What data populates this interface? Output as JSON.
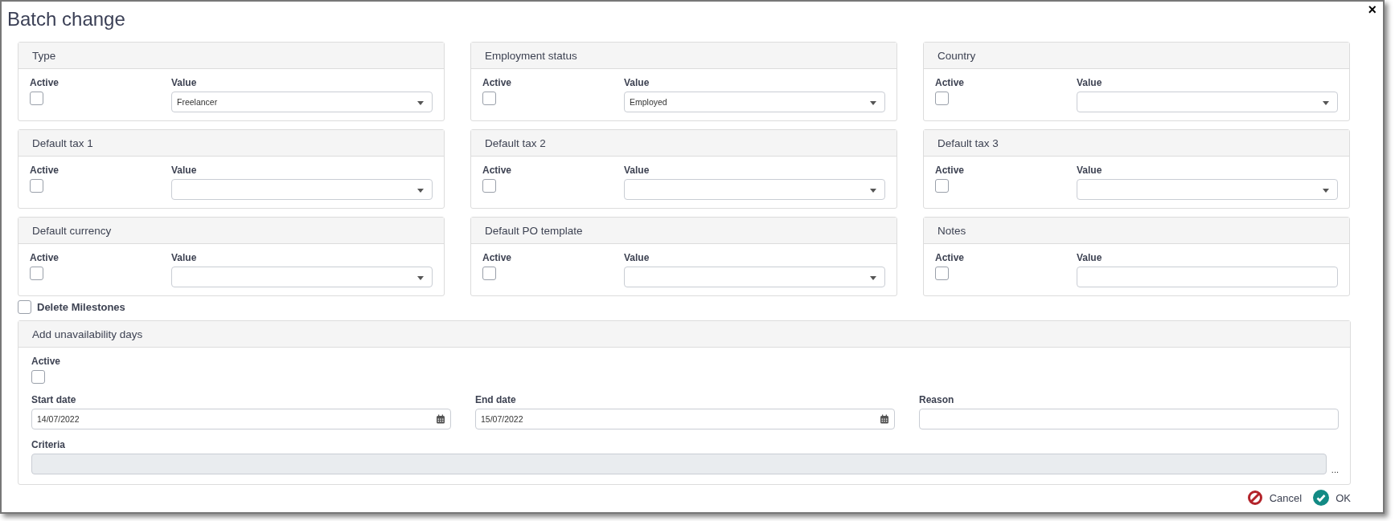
{
  "window": {
    "title": "Batch change",
    "close": "×"
  },
  "panels": [
    {
      "title": "Type",
      "active_label": "Active",
      "active_checked": false,
      "value_label": "Value",
      "kind": "select",
      "value": "Freelancer"
    },
    {
      "title": "Employment status",
      "active_label": "Active",
      "active_checked": false,
      "value_label": "Value",
      "kind": "select",
      "value": "Employed"
    },
    {
      "title": "Country",
      "active_label": "Active",
      "active_checked": false,
      "value_label": "Value",
      "kind": "select"
    },
    {
      "title": "Default tax 1",
      "active_label": "Active",
      "active_checked": false,
      "value_label": "Value",
      "kind": "select"
    },
    {
      "title": "Default tax 2",
      "active_label": "Active",
      "active_checked": false,
      "value_label": "Value",
      "kind": "select"
    },
    {
      "title": "Default tax 3",
      "active_label": "Active",
      "active_checked": false,
      "value_label": "Value",
      "kind": "select"
    },
    {
      "title": "Default currency",
      "active_label": "Active",
      "active_checked": false,
      "value_label": "Value",
      "kind": "select"
    },
    {
      "title": "Default PO template",
      "active_label": "Active",
      "active_checked": false,
      "value_label": "Value",
      "kind": "select"
    },
    {
      "title": "Notes",
      "active_label": "Active",
      "active_checked": false,
      "value_label": "Value",
      "kind": "text"
    }
  ],
  "delete_milestones": {
    "label": "Delete Milestones",
    "checked": false
  },
  "unavailability": {
    "title": "Add unavailability days",
    "active_label": "Active",
    "active_checked": false,
    "fields": [
      {
        "label": "Start date",
        "kind": "date",
        "value": "14/07/2022"
      },
      {
        "label": "End date",
        "kind": "date",
        "value": "15/07/2022"
      },
      {
        "label": "Reason",
        "kind": "text"
      }
    ],
    "criteria": {
      "label": "Criteria",
      "disabled": true,
      "button": "..."
    }
  },
  "buttons": [
    {
      "kind": "cancel",
      "label": "Cancel"
    },
    {
      "kind": "ok",
      "label": "OK"
    }
  ]
}
